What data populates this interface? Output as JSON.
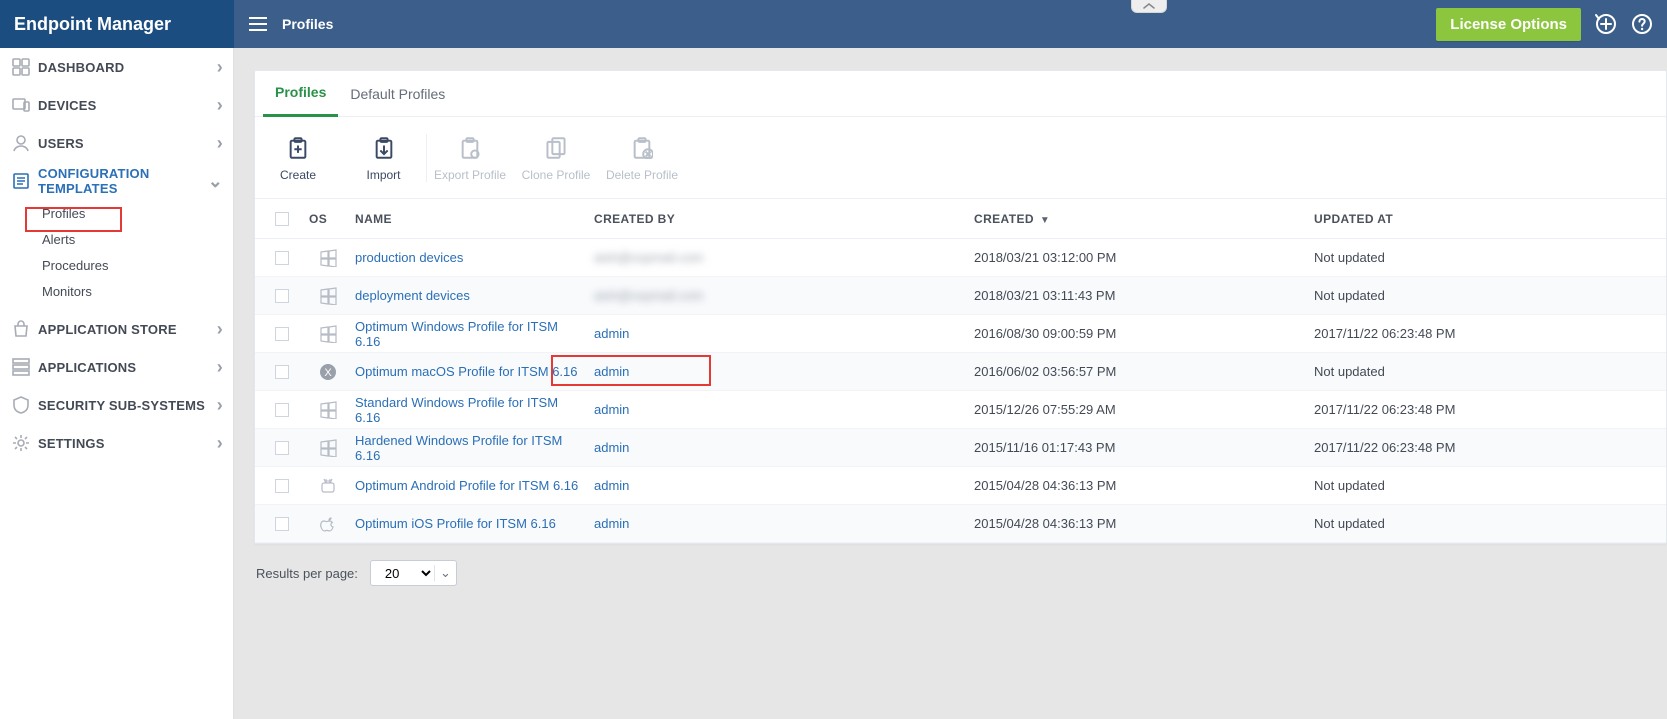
{
  "brand": {
    "title": "Endpoint Manager"
  },
  "topbar": {
    "breadcrumb": "Profiles",
    "license_button": "License Options"
  },
  "sidebar": {
    "items": [
      {
        "icon": "dashboard",
        "label": "DASHBOARD",
        "expandable": true
      },
      {
        "icon": "devices",
        "label": "DEVICES",
        "expandable": true
      },
      {
        "icon": "users",
        "label": "USERS",
        "expandable": true
      },
      {
        "icon": "templates",
        "label": "CONFIGURATION TEMPLATES",
        "active": true,
        "expanded": true,
        "subitems": [
          "Profiles",
          "Alerts",
          "Procedures",
          "Monitors"
        ]
      },
      {
        "icon": "store",
        "label": "APPLICATION STORE",
        "expandable": true
      },
      {
        "icon": "apps",
        "label": "APPLICATIONS",
        "expandable": true
      },
      {
        "icon": "shield",
        "label": "SECURITY SUB-SYSTEMS",
        "expandable": true
      },
      {
        "icon": "settings",
        "label": "SETTINGS",
        "expandable": true
      }
    ]
  },
  "tabs": {
    "items": [
      "Profiles",
      "Default Profiles"
    ],
    "active_index": 0
  },
  "toolbar": {
    "items": [
      {
        "key": "create",
        "label": "Create",
        "enabled": true
      },
      {
        "key": "import",
        "label": "Import",
        "enabled": true
      },
      {
        "key": "export",
        "label": "Export Profile",
        "enabled": false
      },
      {
        "key": "clone",
        "label": "Clone Profile",
        "enabled": false
      },
      {
        "key": "delete",
        "label": "Delete Profile",
        "enabled": false
      }
    ]
  },
  "table": {
    "headers": {
      "os": "OS",
      "name": "NAME",
      "created_by": "CREATED BY",
      "created": "CREATED",
      "updated_at": "UPDATED AT"
    },
    "sort": {
      "column": "created",
      "dir": "desc"
    },
    "rows": [
      {
        "os": "windows",
        "name": "production devices",
        "created_by": "aish@xxpmail.com",
        "created_by_blur": true,
        "created": "2018/03/21 03:12:00 PM",
        "updated": "Not updated"
      },
      {
        "os": "windows",
        "name": "deployment devices",
        "created_by": "aish@xxpmail.com",
        "created_by_blur": true,
        "created": "2018/03/21 03:11:43 PM",
        "updated": "Not updated"
      },
      {
        "os": "windows",
        "name": "Optimum Windows Profile for ITSM 6.16",
        "created_by": "admin",
        "created": "2016/08/30 09:00:59 PM",
        "updated": "2017/11/22 06:23:48 PM"
      },
      {
        "os": "macos",
        "name": "Optimum macOS Profile for ITSM 6.16",
        "created_by": "admin",
        "created": "2016/06/02 03:56:57 PM",
        "updated": "Not updated"
      },
      {
        "os": "windows",
        "name": "Standard Windows Profile for ITSM 6.16",
        "created_by": "admin",
        "created": "2015/12/26 07:55:29 AM",
        "updated": "2017/11/22 06:23:48 PM"
      },
      {
        "os": "windows",
        "name": "Hardened Windows Profile for ITSM 6.16",
        "created_by": "admin",
        "created": "2015/11/16 01:17:43 PM",
        "updated": "2017/11/22 06:23:48 PM"
      },
      {
        "os": "android",
        "name": "Optimum Android Profile for ITSM 6.16",
        "created_by": "admin",
        "created": "2015/04/28 04:36:13 PM",
        "updated": "Not updated"
      },
      {
        "os": "ios",
        "name": "Optimum iOS Profile for ITSM 6.16",
        "created_by": "admin",
        "created": "2015/04/28 04:36:13 PM",
        "updated": "Not updated"
      }
    ]
  },
  "pager": {
    "label": "Results per page:",
    "selected": "20",
    "options": [
      "20"
    ]
  }
}
